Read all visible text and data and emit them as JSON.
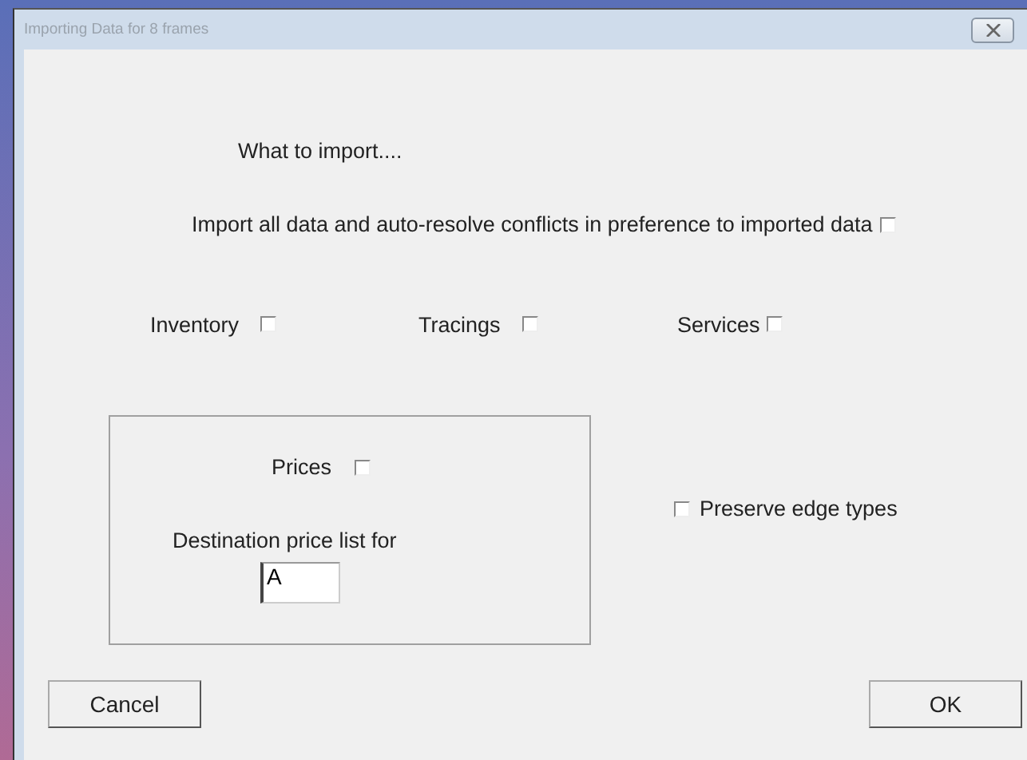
{
  "window": {
    "title": "Importing Data for 8 frames"
  },
  "heading": "What to import....",
  "auto_resolve": {
    "label": "Import all data and auto-resolve conflicts in preference to imported data",
    "checked": false
  },
  "options": [
    {
      "label": "Inventory",
      "checked": false
    },
    {
      "label": "Tracings",
      "checked": false
    },
    {
      "label": "Services",
      "checked": false
    }
  ],
  "prices": {
    "label": "Prices",
    "checked": false,
    "destination_label": "Destination price list for",
    "destination_value": "A"
  },
  "preserve_edge_types": {
    "label": "Preserve edge types",
    "checked": false
  },
  "buttons": [
    "Cancel",
    "OK"
  ]
}
